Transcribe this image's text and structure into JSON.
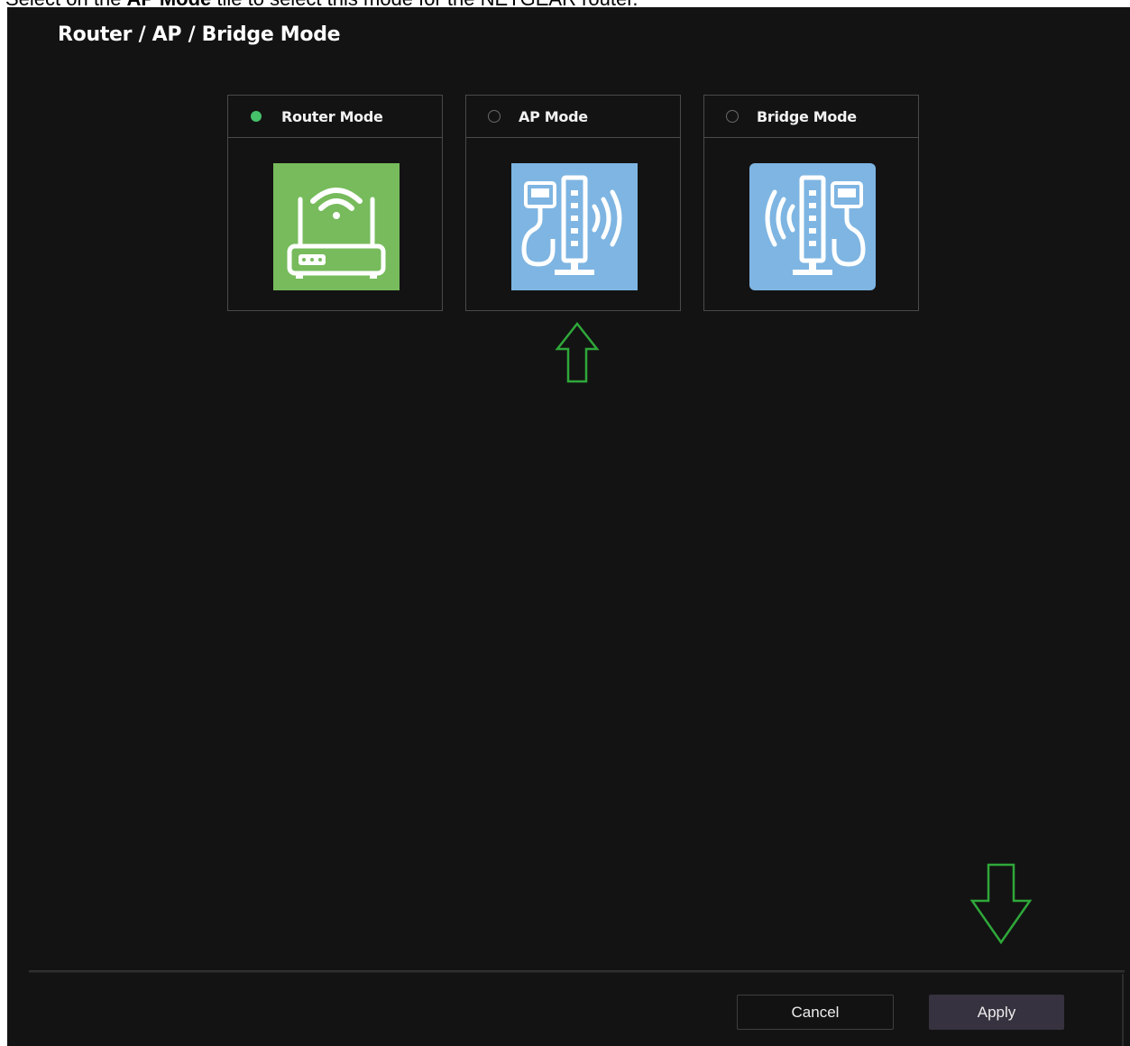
{
  "caption": {
    "prefix": "Select on the ",
    "bold": "AP Mode",
    "suffix": " tile to select this mode for the NETGEAR router."
  },
  "page_title": "Router / AP / Bridge Mode",
  "modes": [
    {
      "label": "Router Mode",
      "selected": true,
      "icon": "router-icon",
      "color": "#77bb5c"
    },
    {
      "label": "AP Mode",
      "selected": false,
      "icon": "access-point-icon",
      "color": "#7eb5e2"
    },
    {
      "label": "Bridge Mode",
      "selected": false,
      "icon": "bridge-icon",
      "color": "#7eb5e2"
    }
  ],
  "buttons": {
    "cancel": "Cancel",
    "apply": "Apply"
  },
  "colors": {
    "background": "#131313",
    "selected_radio": "#45c26a",
    "annotation_arrow": "#2fa83a",
    "apply_button": "#37323f"
  }
}
